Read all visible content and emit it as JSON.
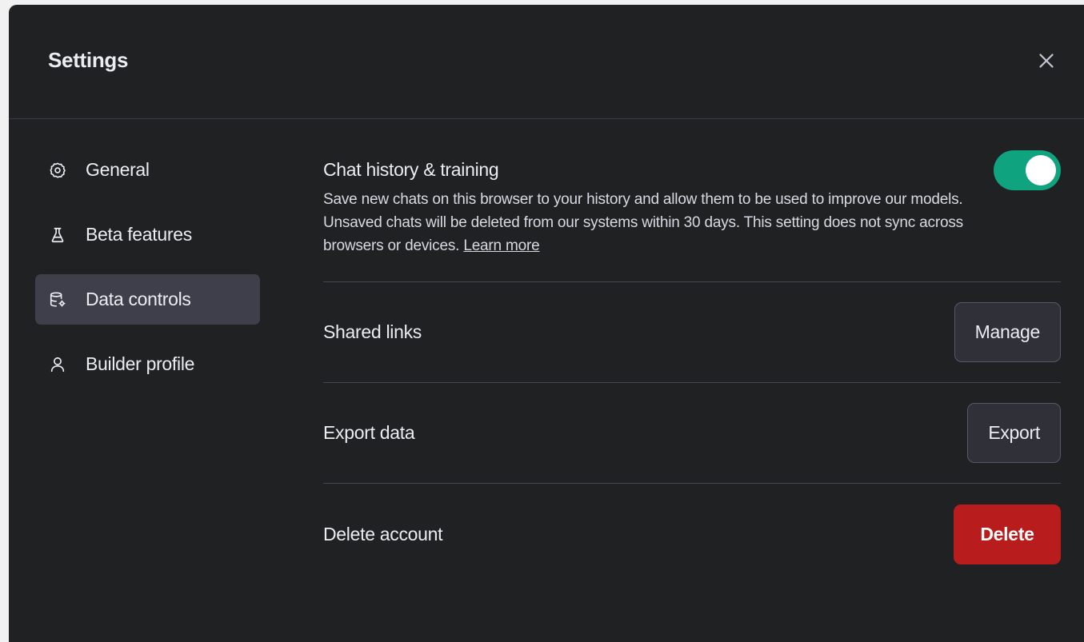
{
  "dialog": {
    "title": "Settings",
    "close_icon": "close-icon"
  },
  "sidebar": {
    "items": [
      {
        "label": "General",
        "icon": "gear-icon",
        "active": false
      },
      {
        "label": "Beta features",
        "icon": "flask-icon",
        "active": false
      },
      {
        "label": "Data controls",
        "icon": "database-icon",
        "active": true
      },
      {
        "label": "Builder profile",
        "icon": "person-icon",
        "active": false
      }
    ]
  },
  "content": {
    "chat_history": {
      "title": "Chat history & training",
      "description": "Save new chats on this browser to your history and allow them to be used to improve our models. Unsaved chats will be deleted from our systems within 30 days. This setting does not sync across browsers or devices.",
      "learn_more": "Learn more",
      "toggle_on": true,
      "toggle_color": "#10a37f"
    },
    "shared_links": {
      "label": "Shared links",
      "button": "Manage"
    },
    "export_data": {
      "label": "Export data",
      "button": "Export"
    },
    "delete_account": {
      "label": "Delete account",
      "button": "Delete",
      "button_color": "#b91c1c"
    }
  }
}
